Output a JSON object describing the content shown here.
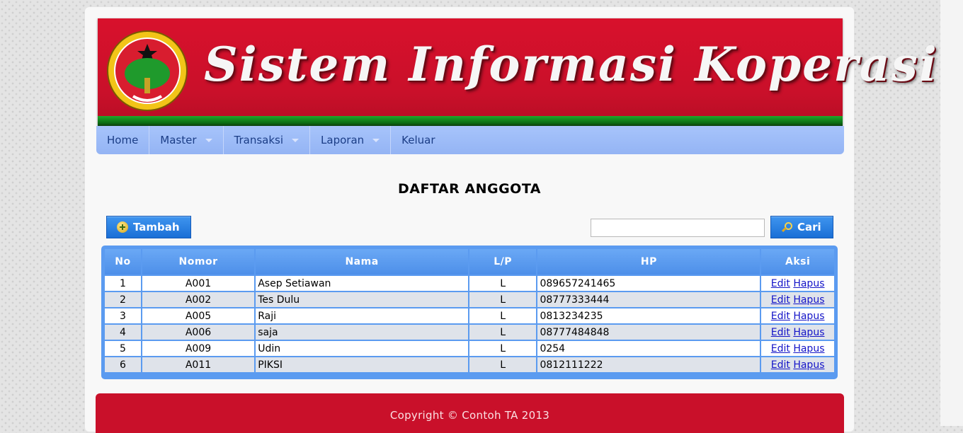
{
  "header": {
    "banner_title": "Sistem Informasi Koperasi",
    "emblem_label": "KOPERASI INDONESIA"
  },
  "nav": {
    "items": [
      {
        "label": "Home",
        "dropdown": false
      },
      {
        "label": "Master",
        "dropdown": true
      },
      {
        "label": "Transaksi",
        "dropdown": true
      },
      {
        "label": "Laporan",
        "dropdown": true
      },
      {
        "label": "Keluar",
        "dropdown": false
      }
    ]
  },
  "main": {
    "title": "DAFTAR ANGGOTA",
    "add_button_label": "Tambah",
    "search_button_label": "Cari",
    "search_value": ""
  },
  "table": {
    "columns": [
      "No",
      "Nomor",
      "Nama",
      "L/P",
      "HP",
      "Aksi"
    ],
    "edit_label": "Edit",
    "delete_label": "Hapus",
    "rows": [
      {
        "no": "1",
        "nomor": "A001",
        "nama": "Asep Setiawan",
        "lp": "L",
        "hp": "089657241465"
      },
      {
        "no": "2",
        "nomor": "A002",
        "nama": "Tes Dulu",
        "lp": "L",
        "hp": "08777333444"
      },
      {
        "no": "3",
        "nomor": "A005",
        "nama": "Raji",
        "lp": "L",
        "hp": "0813234235"
      },
      {
        "no": "4",
        "nomor": "A006",
        "nama": "saja",
        "lp": "L",
        "hp": "08777484848"
      },
      {
        "no": "5",
        "nomor": "A009",
        "nama": "Udin",
        "lp": "L",
        "hp": "0254"
      },
      {
        "no": "6",
        "nomor": "A011",
        "nama": "PIKSI",
        "lp": "L",
        "hp": "0812111222"
      }
    ]
  },
  "footer": {
    "copyright": "Copyright © Contoh TA 2013"
  },
  "colors": {
    "banner_red": "#c9102a",
    "nav_blue": "#a7c4fb",
    "button_blue": "#1a6fd6",
    "table_border": "#5b9bf0"
  },
  "icons": {
    "add_button": "plus-circle-icon",
    "search_button": "magnifier-icon",
    "nav_dropdown": "caret-down-icon"
  }
}
